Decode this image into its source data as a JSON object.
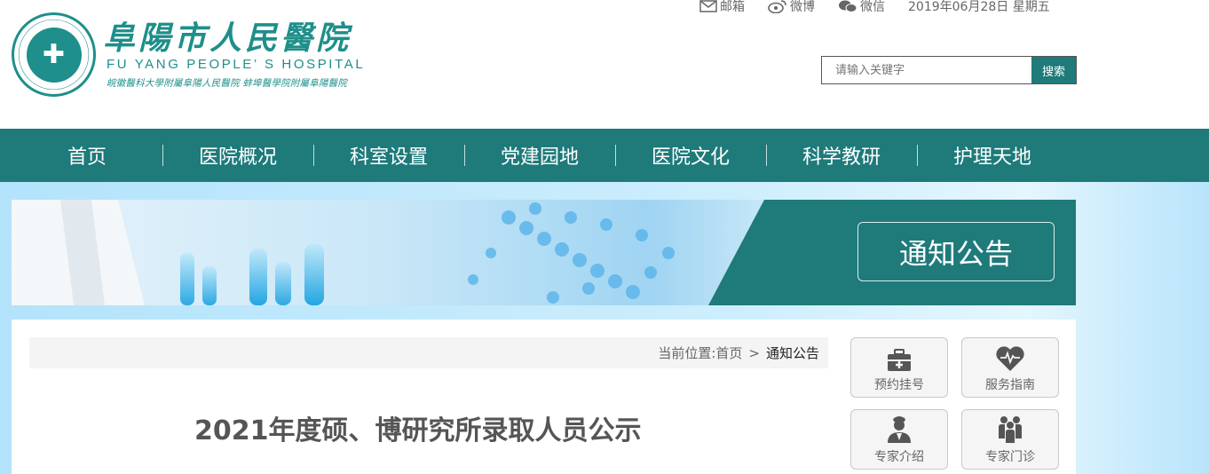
{
  "header": {
    "logo_char": "✚",
    "site_name_cn": "阜陽市人民醫院",
    "site_name_en": "FU  YANG  PEOPLE’ S  HOSPITAL",
    "site_sub": "皖徽醫科大學附屬阜陽人民醫院  蚌埠醫學院附屬阜陽醫院",
    "links": [
      {
        "label": "邮箱",
        "icon": "mail-icon"
      },
      {
        "label": "微博",
        "icon": "weibo-icon"
      },
      {
        "label": "微信",
        "icon": "wechat-icon"
      }
    ],
    "date": "2019年06月28日 星期五",
    "search": {
      "placeholder": "请输入关键字",
      "button": "搜索"
    }
  },
  "nav": {
    "items": [
      "首页",
      "医院概况",
      "科室设置",
      "党建园地",
      "医院文化",
      "科学教研",
      "护理天地"
    ]
  },
  "banner": {
    "title": "通知公告"
  },
  "breadcrumb": {
    "prefix": "当前位置:",
    "home": "首页",
    "sep": ">",
    "current": "通知公告"
  },
  "article": {
    "title": "2021年度硕、博研究所录取人员公示"
  },
  "quick_links": [
    {
      "label": "预约挂号",
      "icon": "medical-kit-icon"
    },
    {
      "label": "服务指南",
      "icon": "heart-icon"
    },
    {
      "label": "专家介绍",
      "icon": "doctor-icon"
    },
    {
      "label": "专家门诊",
      "icon": "people-group-icon"
    }
  ],
  "colors": {
    "brand": "#1f7a7a",
    "logo": "#1e8f8a",
    "bg": "#b3e3fb"
  }
}
